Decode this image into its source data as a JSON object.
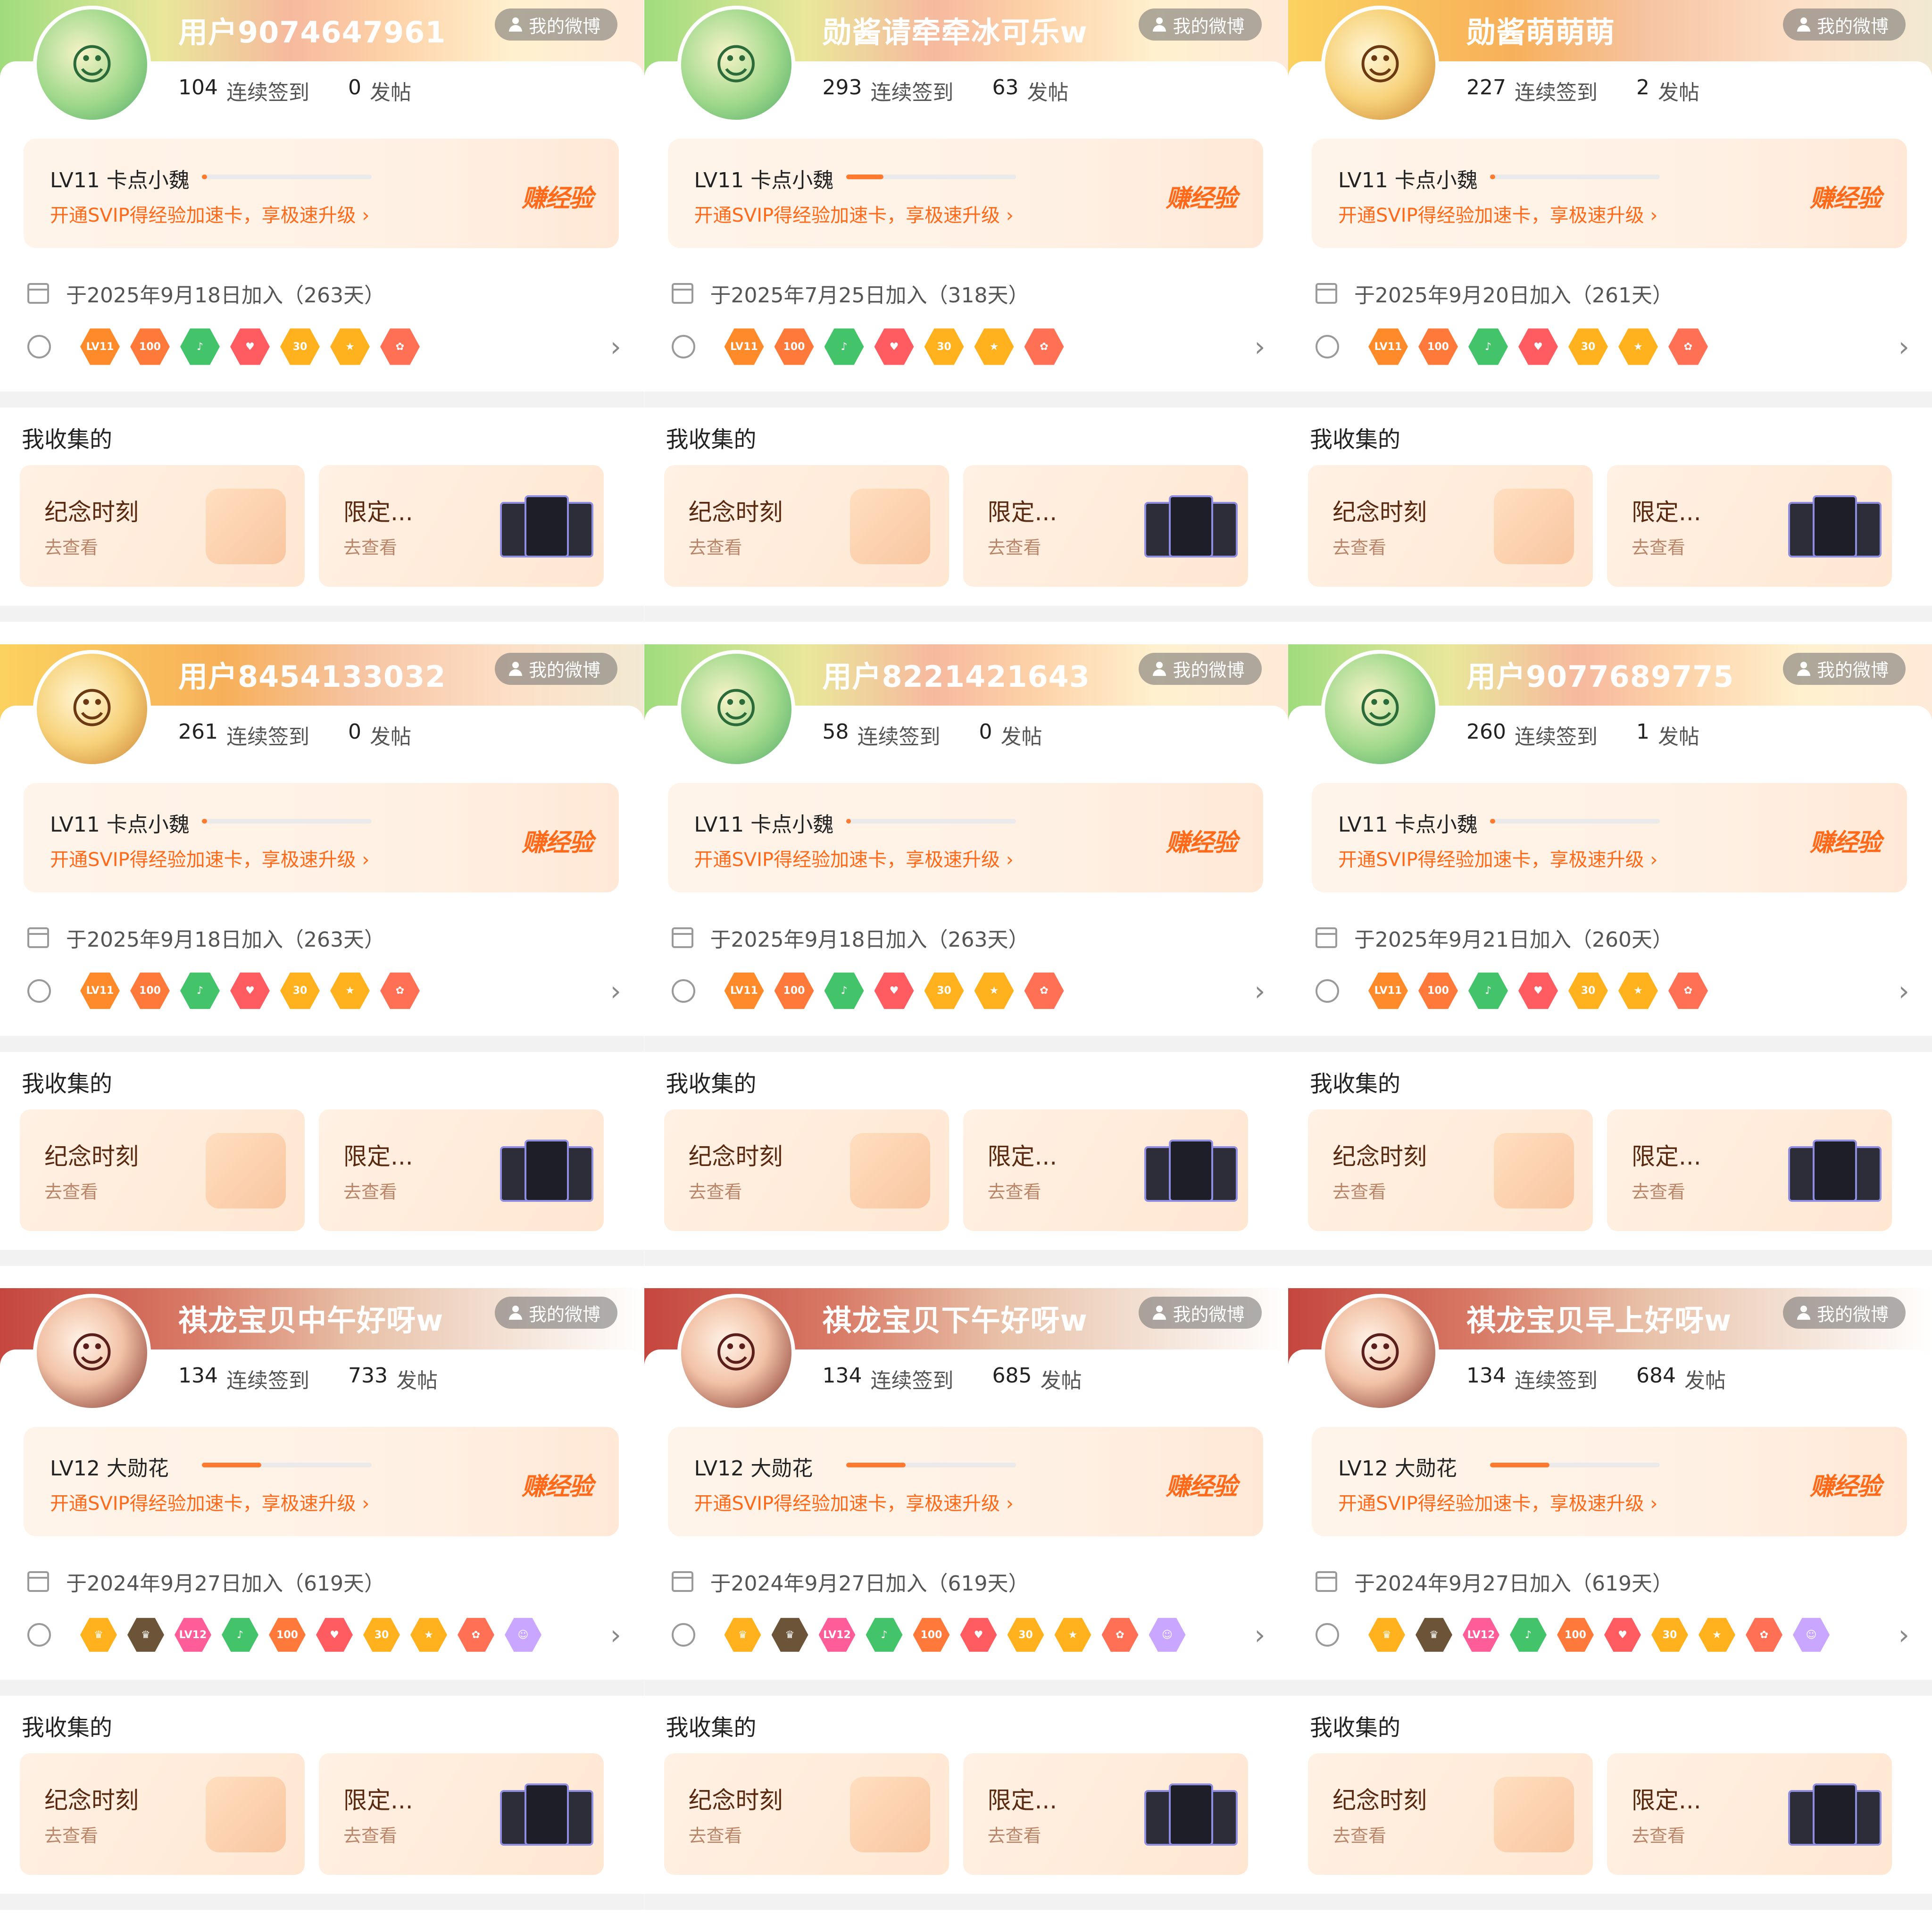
{
  "ui": {
    "my_weibo": "我的微博",
    "checkin_label": "连续签到",
    "posts_label": "发帖",
    "svip_text": "开通SVIP得经验加速卡，享极速升级 ›",
    "earn_exp": "赚经验",
    "collected_title": "我收集的",
    "tile_memorial": "纪念时刻",
    "tile_limited": "限定...",
    "tile_view": "去查看",
    "arrow": "›"
  },
  "panels": [
    {
      "username": "用户9074647961",
      "checkin": "104",
      "posts": "0",
      "level": "LV11 卡点小魏",
      "level_progress": 0.02,
      "joined": "于2025年9月18日加入（263天）"
    },
    {
      "username": "勋酱请牵牵冰可乐w",
      "checkin": "293",
      "posts": "63",
      "level": "LV11 卡点小魏",
      "level_progress": 0.22,
      "joined": "于2025年7月25日加入（318天）"
    },
    {
      "username": "勋酱萌萌萌",
      "checkin": "227",
      "posts": "2",
      "level": "LV11 卡点小魏",
      "level_progress": 0.03,
      "joined": "于2025年9月20日加入（261天）"
    },
    {
      "username": "用户8454133032",
      "checkin": "261",
      "posts": "0",
      "level": "LV11 卡点小魏",
      "level_progress": 0.03,
      "joined": "于2025年9月18日加入（263天）"
    },
    {
      "username": "用户8221421643",
      "checkin": "58",
      "posts": "0",
      "level": "LV11 卡点小魏",
      "level_progress": 0.01,
      "joined": "于2025年9月18日加入（263天）"
    },
    {
      "username": "用户9077689775",
      "checkin": "260",
      "posts": "1",
      "level": "LV11 卡点小魏",
      "level_progress": 0.03,
      "joined": "于2025年9月21日加入（260天）"
    },
    {
      "username": "祺龙宝贝中午好呀w",
      "checkin": "134",
      "posts": "733",
      "level": "LV12 大勋花",
      "level_progress": 0.35,
      "joined": "于2024年9月27日加入（619天）"
    },
    {
      "username": "祺龙宝贝下午好呀w",
      "checkin": "134",
      "posts": "685",
      "level": "LV12 大勋花",
      "level_progress": 0.35,
      "joined": "于2024年9月27日加入（619天）"
    },
    {
      "username": "祺龙宝贝早上好呀w",
      "checkin": "134",
      "posts": "684",
      "level": "LV12 大勋花",
      "level_progress": 0.35,
      "joined": "于2024年9月27日加入（619天）"
    }
  ],
  "badge_sets": {
    "short": [
      {
        "text": "LV11",
        "color": "#ff8a2a"
      },
      {
        "text": "100",
        "color": "#ff7a3a"
      },
      {
        "text": "♪",
        "color": "#43c46a"
      },
      {
        "text": "♥",
        "color": "#ff5c62"
      },
      {
        "text": "30",
        "color": "#ffb21e"
      },
      {
        "text": "★",
        "color": "#ffb21e"
      },
      {
        "text": "✿",
        "color": "#ff7055"
      }
    ],
    "long": [
      {
        "text": "♛",
        "color": "#ffb21e"
      },
      {
        "text": "♛",
        "color": "#6b5438"
      },
      {
        "text": "LV12",
        "color": "#ff5c9a"
      },
      {
        "text": "♪",
        "color": "#43c46a"
      },
      {
        "text": "100",
        "color": "#ff7a3a"
      },
      {
        "text": "♥",
        "color": "#ff5c62"
      },
      {
        "text": "30",
        "color": "#ffb21e"
      },
      {
        "text": "★",
        "color": "#ffb21e"
      },
      {
        "text": "✿",
        "color": "#ff7055"
      },
      {
        "text": "☺",
        "color": "#c9a6ff"
      }
    ]
  }
}
